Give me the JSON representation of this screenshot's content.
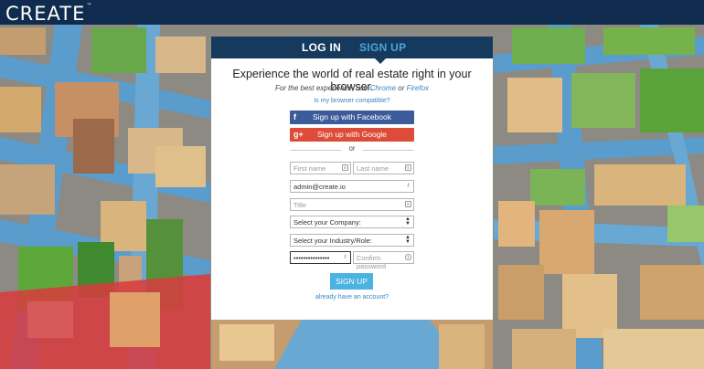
{
  "app": {
    "logo": "CREATE",
    "logo_tm": "™"
  },
  "tabs": {
    "login": "LOG IN",
    "signup": "SIGN UP"
  },
  "headline": "Experience the world of real estate right in your browser.",
  "browser_note": {
    "prefix": "For the best experience, use",
    "chrome": "Chrome",
    "or": "or",
    "firefox": "Firefox"
  },
  "compat_link": "Is my browser compatible?",
  "social": {
    "facebook": {
      "label": "Sign up with Facebook",
      "icon": "f"
    },
    "google": {
      "label": "Sign up with Google",
      "icon": "g+"
    }
  },
  "divider": "or",
  "form": {
    "first_name_placeholder": "First name",
    "last_name_placeholder": "Last name",
    "email_value": "admin@create.io",
    "title_placeholder": "Title",
    "company_select": "Select your Company:",
    "industry_select": "Select your Industry/Role:",
    "password_value": "•••••••••••••••",
    "confirm_placeholder": "Confirm password",
    "submit": "SIGN UP"
  },
  "have_account": "already have an account?",
  "colors": {
    "navbar": "#0f2c4e",
    "tab_bar": "#153a5e",
    "accent": "#4bb2e2",
    "facebook": "#3b5b9b",
    "google": "#dd4b39"
  }
}
